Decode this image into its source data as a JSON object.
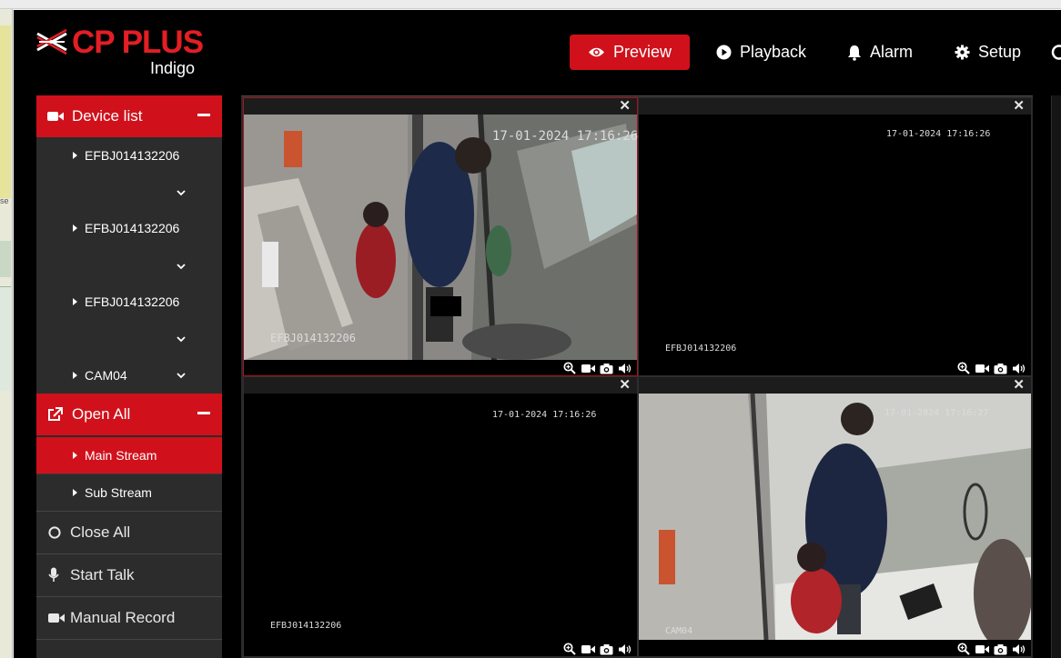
{
  "brand": {
    "name": "CP PLUS",
    "product": "Indigo",
    "accent": "#d0111b"
  },
  "nav": {
    "preview": "Preview",
    "playback": "Playback",
    "alarm": "Alarm",
    "setup": "Setup"
  },
  "sidebar": {
    "device_list_label": "Device list",
    "devices": [
      {
        "label": "EFBJ014132206"
      },
      {
        "label": "EFBJ014132206"
      },
      {
        "label": "EFBJ014132206"
      },
      {
        "label": "CAM04"
      }
    ],
    "open_all_label": "Open All",
    "streams": [
      {
        "label": "Main Stream",
        "active": true
      },
      {
        "label": "Sub Stream",
        "active": false
      }
    ],
    "close_all_label": "Close All",
    "start_talk_label": "Start Talk",
    "manual_record_label": "Manual Record"
  },
  "cells": [
    {
      "timestamp": "17-01-2024 17:16:26",
      "name": "EFBJ014132206",
      "feed": "live"
    },
    {
      "timestamp": "17-01-2024 17:16:26",
      "name": "EFBJ014132206",
      "feed": "blank"
    },
    {
      "timestamp": "17-01-2024 17:16:26",
      "name": "EFBJ014132206",
      "feed": "blank"
    },
    {
      "timestamp": "17-01-2024 17:16:27",
      "name": "CAM04",
      "feed": "live"
    }
  ],
  "icons": {
    "nav": [
      "eye-icon",
      "play-circle-icon",
      "bell-icon",
      "gear-icon"
    ],
    "cell_controls": [
      "zoom-icon",
      "record-icon",
      "snapshot-icon",
      "audio-icon"
    ]
  }
}
